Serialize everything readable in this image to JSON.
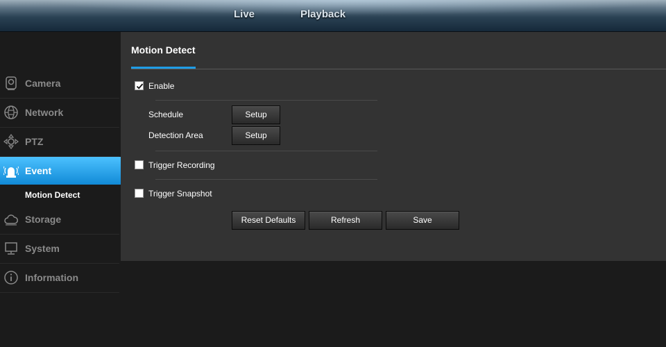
{
  "topnav": {
    "live": "Live",
    "playback": "Playback"
  },
  "sidebar": {
    "items": [
      {
        "label": "Camera",
        "icon": "camera-icon"
      },
      {
        "label": "Network",
        "icon": "network-icon"
      },
      {
        "label": "PTZ",
        "icon": "ptz-icon"
      },
      {
        "label": "Event",
        "icon": "alarm-icon",
        "active": true
      },
      {
        "label": "Storage",
        "icon": "cloud-icon"
      },
      {
        "label": "System",
        "icon": "monitor-icon"
      },
      {
        "label": "Information",
        "icon": "info-icon"
      }
    ],
    "subitem": "Motion Detect"
  },
  "content": {
    "tab": "Motion Detect",
    "enable": {
      "label": "Enable",
      "checked": true
    },
    "schedule": {
      "label": "Schedule",
      "button": "Setup"
    },
    "detection_area": {
      "label": "Detection Area",
      "button": "Setup"
    },
    "trigger_recording": {
      "label": "Trigger Recording",
      "checked": false
    },
    "trigger_snapshot": {
      "label": "Trigger Snapshot",
      "checked": false
    },
    "buttons": {
      "reset": "Reset Defaults",
      "refresh": "Refresh",
      "save": "Save"
    }
  },
  "colors": {
    "accent": "#1e9ce6",
    "panel": "#333333",
    "background": "#1b1b1b"
  }
}
